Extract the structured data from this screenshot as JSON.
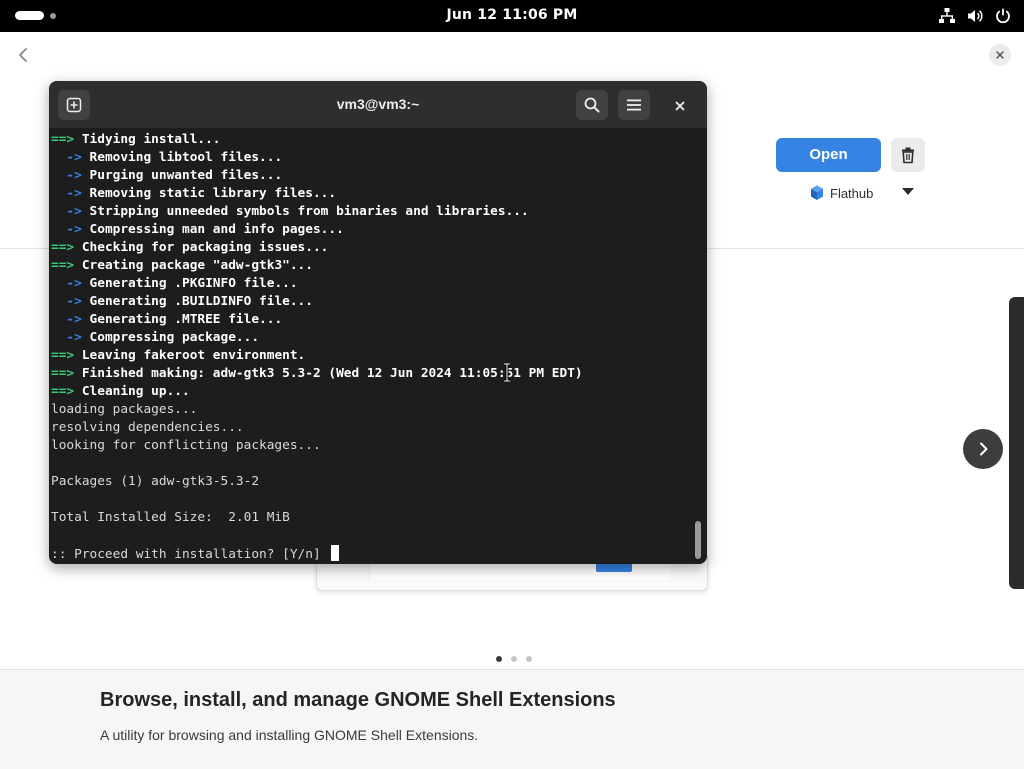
{
  "topbar": {
    "clock": "Jun 12  11:06 PM",
    "icons": [
      "activities-indicator",
      "network-wired-icon",
      "volume-icon",
      "power-icon"
    ]
  },
  "software": {
    "open_label": "Open",
    "source_label": "Flathub",
    "headline": "Browse, install, and manage GNOME Shell Extensions",
    "description": "A utility for browsing and installing GNOME Shell Extensions.",
    "carousel_pages": 3,
    "carousel_active": 0,
    "accent": "#3584e4"
  },
  "terminal": {
    "title": "vm3@vm3:~",
    "scroll_position": 1.0,
    "lines": [
      {
        "prefix": "==>",
        "kind": "green",
        "text": " Tidying install...",
        "bold": true
      },
      {
        "prefix": "  ->",
        "kind": "blue",
        "text": " Removing libtool files...",
        "bold": true
      },
      {
        "prefix": "  ->",
        "kind": "blue",
        "text": " Purging unwanted files...",
        "bold": true
      },
      {
        "prefix": "  ->",
        "kind": "blue",
        "text": " Removing static library files...",
        "bold": true
      },
      {
        "prefix": "  ->",
        "kind": "blue",
        "text": " Stripping unneeded symbols from binaries and libraries...",
        "bold": true
      },
      {
        "prefix": "  ->",
        "kind": "blue",
        "text": " Compressing man and info pages...",
        "bold": true
      },
      {
        "prefix": "==>",
        "kind": "green",
        "text": " Checking for packaging issues...",
        "bold": true
      },
      {
        "prefix": "==>",
        "kind": "green",
        "text": " Creating package \"adw-gtk3\"...",
        "bold": true
      },
      {
        "prefix": "  ->",
        "kind": "blue",
        "text": " Generating .PKGINFO file...",
        "bold": true
      },
      {
        "prefix": "  ->",
        "kind": "blue",
        "text": " Generating .BUILDINFO file...",
        "bold": true
      },
      {
        "prefix": "  ->",
        "kind": "blue",
        "text": " Generating .MTREE file...",
        "bold": true
      },
      {
        "prefix": "  ->",
        "kind": "blue",
        "text": " Compressing package...",
        "bold": true
      },
      {
        "prefix": "==>",
        "kind": "green",
        "text": " Leaving fakeroot environment.",
        "bold": true
      },
      {
        "prefix": "==>",
        "kind": "green",
        "text": " Finished making: adw-gtk3 5.3-2 (Wed 12 Jun 2024 11:05:51 PM EDT)",
        "bold": true
      },
      {
        "prefix": "==>",
        "kind": "green",
        "text": " Cleaning up...",
        "bold": true
      },
      {
        "prefix": "",
        "kind": "plain",
        "text": "loading packages...",
        "bold": false
      },
      {
        "prefix": "",
        "kind": "plain",
        "text": "resolving dependencies...",
        "bold": false
      },
      {
        "prefix": "",
        "kind": "plain",
        "text": "looking for conflicting packages...",
        "bold": false
      },
      {
        "prefix": "",
        "kind": "plain",
        "text": "",
        "bold": false
      },
      {
        "prefix": "",
        "kind": "plain",
        "text": "Packages (1) adw-gtk3-5.3-2",
        "bold": false
      },
      {
        "prefix": "",
        "kind": "plain",
        "text": "",
        "bold": false
      },
      {
        "prefix": "",
        "kind": "plain",
        "text": "Total Installed Size:  2.01 MiB",
        "bold": false
      },
      {
        "prefix": "",
        "kind": "plain",
        "text": "",
        "bold": false
      },
      {
        "prefix": "",
        "kind": "plain",
        "text": ":: Proceed with installation? [Y/n] ",
        "bold": false,
        "cursor": true
      }
    ]
  }
}
